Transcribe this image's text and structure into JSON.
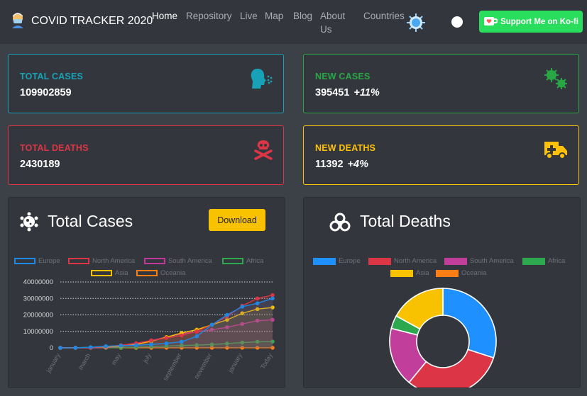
{
  "navbar": {
    "brand": "COVID TRACKER 2020",
    "links": [
      {
        "label": "Home",
        "active": true
      },
      {
        "label": "Repository",
        "active": false
      },
      {
        "label": "Live",
        "active": false
      },
      {
        "label": "Map",
        "active": false
      },
      {
        "label": "Blog",
        "active": false
      },
      {
        "label": "About",
        "label2": "Us",
        "active": false
      },
      {
        "label": "Countries",
        "active": false
      }
    ],
    "kofi_label": "Support Me on Ko-fi",
    "icons": [
      "mask-face-icon",
      "virus-theme-icon",
      "toggle-dot"
    ]
  },
  "cards": {
    "total_cases": {
      "title": "TOTAL CASES",
      "value": "109902859",
      "color": "#17a2b8",
      "icon": "coughing-head-icon"
    },
    "new_cases": {
      "title": "NEW CASES",
      "value": "395451",
      "pct": "+11%",
      "color": "#28a745",
      "icon": "viruses-icon"
    },
    "total_deaths": {
      "title": "TOTAL DEATHS",
      "value": "2430189",
      "color": "#dc3545",
      "icon": "skull-crossbones-icon"
    },
    "new_deaths": {
      "title": "NEW DEATHS",
      "value": "11392",
      "pct": "+4%",
      "color": "#ffc107",
      "icon": "ambulance-icon"
    }
  },
  "cases_panel": {
    "title": "Total Cases",
    "download_label": "Download",
    "icon": "virus-icon"
  },
  "deaths_panel": {
    "title": "Total Deaths",
    "icon": "biohazard-icon"
  },
  "chart_data": [
    {
      "type": "line",
      "x": [
        "january",
        "february",
        "march",
        "april",
        "may",
        "june",
        "july",
        "august",
        "september",
        "october",
        "november",
        "december",
        "january",
        "february",
        "Today"
      ],
      "x_tick_labels": [
        "january",
        "march",
        "may",
        "july",
        "september",
        "november",
        "january",
        "Today"
      ],
      "y_ticks": [
        "0",
        "10000000",
        "20000000",
        "30000000",
        "40000000"
      ],
      "ylim": [
        0,
        40000000
      ],
      "grid": "horizontal-dotted",
      "legend_position": "top",
      "series": [
        {
          "name": "Europe",
          "color": "#1e88e5",
          "values": [
            0,
            10000,
            400000,
            1000000,
            1300000,
            1600000,
            2100000,
            2700000,
            3700000,
            7000000,
            14000000,
            20000000,
            25000000,
            27000000,
            30000000
          ]
        },
        {
          "name": "North America",
          "color": "#dc3545",
          "values": [
            0,
            10000,
            150000,
            800000,
            1600000,
            2800000,
            4500000,
            6000000,
            7500000,
            10000000,
            14000000,
            19000000,
            25500000,
            30000000,
            32000000
          ]
        },
        {
          "name": "South America",
          "color": "#c1379a",
          "values": [
            0,
            0,
            10000,
            200000,
            900000,
            2500000,
            4500000,
            6500000,
            8500000,
            9800000,
            11000000,
            12500000,
            14500000,
            16500000,
            17000000
          ]
        },
        {
          "name": "Africa",
          "color": "#2da84e",
          "values": [
            0,
            0,
            5000,
            40000,
            150000,
            400000,
            800000,
            1100000,
            1400000,
            1700000,
            2000000,
            2600000,
            3200000,
            3700000,
            3800000
          ]
        },
        {
          "name": "Asia",
          "color": "#f8c200",
          "values": [
            0,
            80000,
            250000,
            500000,
            1000000,
            2000000,
            4000000,
            6500000,
            9000000,
            11000000,
            14000000,
            17000000,
            21000000,
            23500000,
            24500000
          ]
        },
        {
          "name": "Oceania",
          "color": "#fd7e14",
          "values": [
            0,
            0,
            5000,
            8000,
            9000,
            10000,
            15000,
            25000,
            30000,
            35000,
            38000,
            42000,
            45000,
            47000,
            48000
          ]
        }
      ]
    },
    {
      "type": "pie",
      "donut": true,
      "legend_position": "top",
      "series": [
        {
          "name": "Europe",
          "color": "#1e90ff",
          "value": 30.0
        },
        {
          "name": "North America",
          "color": "#dc3545",
          "value": 31.0
        },
        {
          "name": "South America",
          "color": "#c23e9b",
          "value": 18.0
        },
        {
          "name": "Africa",
          "color": "#2da84e",
          "value": 4.0
        },
        {
          "name": "Asia",
          "color": "#f8c200",
          "value": 17.0
        },
        {
          "name": "Oceania",
          "color": "#fd7e14",
          "value": 0.04
        }
      ]
    }
  ]
}
